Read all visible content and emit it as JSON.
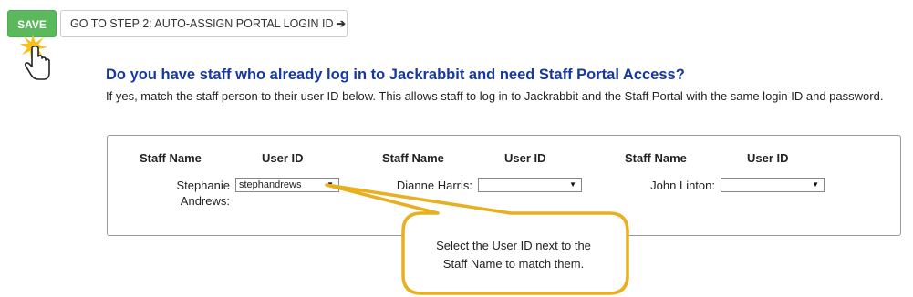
{
  "toolbar": {
    "save_label": "SAVE",
    "step2_label": "GO TO STEP 2: AUTO-ASSIGN PORTAL LOGIN ID",
    "step2_arrow": "➔"
  },
  "section": {
    "heading": "Do you have staff who already log in to Jackrabbit and need Staff Portal Access?",
    "description": "If yes, match the staff person to their user ID below. This allows staff to log in to Jackrabbit and the Staff Portal with the same login ID and password."
  },
  "table": {
    "header_staff_name": "Staff Name",
    "header_user_id": "User ID",
    "rows": [
      {
        "staff_name_line1": "Stephanie",
        "staff_name_line2": "Andrews:",
        "user_id": "stephandrews"
      },
      {
        "staff_name": "Dianne Harris:",
        "user_id": ""
      },
      {
        "staff_name": "John Linton:",
        "user_id": ""
      }
    ],
    "dropdown_caret": "▼"
  },
  "callout": {
    "line1": "Select the User ID next to the",
    "line2": "Staff Name to match them."
  },
  "colors": {
    "save_green": "#5cb85c",
    "heading_blue": "#17389e",
    "callout_border": "#e8b01e"
  },
  "icons": [
    "hand-pointer-cursor-icon",
    "click-burst-icon",
    "arrow-right-icon",
    "dropdown-caret-icon"
  ]
}
